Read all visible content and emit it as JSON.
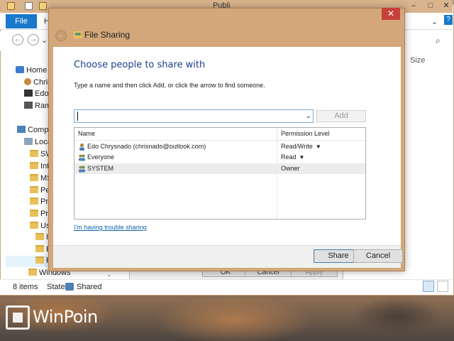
{
  "explorer": {
    "title": "Publi",
    "file_tab": "File",
    "h_tab": "H",
    "size_column": "Size",
    "tree": {
      "homegroup": "Home",
      "users": [
        "Chris",
        "Edo",
        "Ram"
      ],
      "computer": "Comp",
      "local_disk": "Loca",
      "folders": [
        "SW",
        "Int",
        "MS",
        "Pe",
        "Pro",
        "Pro",
        "Us",
        "I",
        "E",
        "F"
      ],
      "windows": "Windows"
    },
    "status": {
      "items": "8 items",
      "state_label": "State:",
      "state_value": "Shared"
    }
  },
  "background_dialog": {
    "ok": "OK",
    "cancel": "Cancel",
    "apply": "Apply"
  },
  "brand": {
    "text": "WinPoin"
  },
  "dialog": {
    "title": "File Sharing",
    "heading": "Choose people to share with",
    "instruction": "Type a name and then click Add, or click the arrow to find someone.",
    "input": {
      "value": "",
      "placeholder": ""
    },
    "add_label": "Add",
    "columns": {
      "name": "Name",
      "permission": "Permission Level"
    },
    "rows": [
      {
        "name": "Edo Chrysnado (chrisnado@outlook.com)",
        "permission": "Read/Write",
        "has_arrow": true,
        "icon": "user-icon"
      },
      {
        "name": "Everyone",
        "permission": "Read",
        "has_arrow": true,
        "icon": "group-icon"
      },
      {
        "name": "SYSTEM",
        "permission": "Owner",
        "has_arrow": false,
        "icon": "group-icon"
      }
    ],
    "trouble_link": "I'm having trouble sharing",
    "share_label": "Share",
    "cancel_label": "Cancel",
    "colors": {
      "frame": "#d3a77a",
      "close": "#c7413a",
      "heading": "#1b3f8b",
      "link": "#0f63a8",
      "accent": "#1979ca"
    }
  }
}
